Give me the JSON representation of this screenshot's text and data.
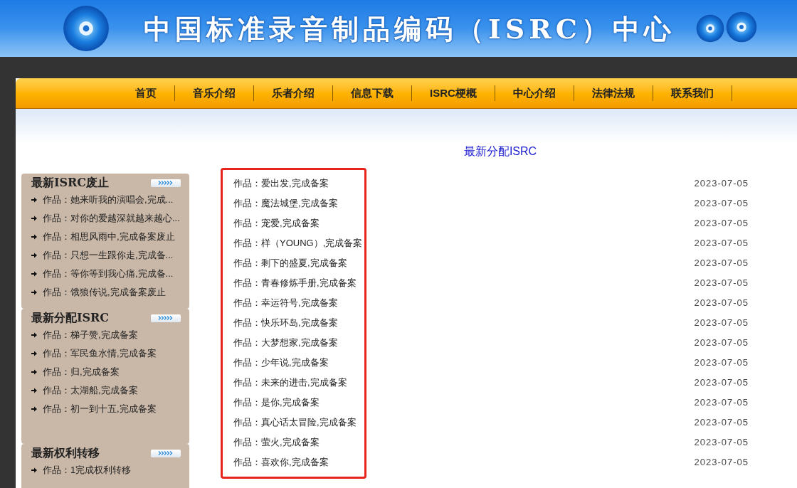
{
  "header": {
    "title": "中国标准录音制品编码（ISRC）中心"
  },
  "nav": [
    {
      "label": "首页"
    },
    {
      "label": "音乐介绍"
    },
    {
      "label": "乐者介绍"
    },
    {
      "label": "信息下载"
    },
    {
      "label": "ISRC梗概"
    },
    {
      "label": "中心介绍"
    },
    {
      "label": "法律法规"
    },
    {
      "label": "联系我们"
    }
  ],
  "sidebar": [
    {
      "title": "最新ISRC废止",
      "items": [
        "作品：她来听我的演唱会,完成...",
        "作品：对你的爱越深就越来越心...",
        "作品：相思风雨中,完成备案废止",
        "作品：只想一生跟你走,完成备...",
        "作品：等你等到我心痛,完成备...",
        "作品：饿狼传说,完成备案废止"
      ]
    },
    {
      "title": "最新分配ISRC",
      "items": [
        "作品：梯子赞,完成备案",
        "作品：军民鱼水情,完成备案",
        "作品：归,完成备案",
        "作品：太湖船,完成备案",
        "作品：初一到十五,完成备案"
      ]
    },
    {
      "title": "最新权利转移",
      "items": [
        "作品：1完成权利转移"
      ]
    }
  ],
  "main": {
    "title": "最新分配ISRC",
    "rows": [
      {
        "text": "作品：爱出发,完成备案",
        "date": "2023-07-05"
      },
      {
        "text": "作品：魔法城堡,完成备案",
        "date": "2023-07-05"
      },
      {
        "text": "作品：宠爱,完成备案",
        "date": "2023-07-05"
      },
      {
        "text": "作品：样（YOUNG）,完成备案",
        "date": "2023-07-05"
      },
      {
        "text": "作品：剩下的盛夏,完成备案",
        "date": "2023-07-05"
      },
      {
        "text": "作品：青春修炼手册,完成备案",
        "date": "2023-07-05"
      },
      {
        "text": "作品：幸运符号,完成备案",
        "date": "2023-07-05"
      },
      {
        "text": "作品：快乐环岛,完成备案",
        "date": "2023-07-05"
      },
      {
        "text": "作品：大梦想家,完成备案",
        "date": "2023-07-05"
      },
      {
        "text": "作品：少年说,完成备案",
        "date": "2023-07-05"
      },
      {
        "text": "作品：未来的进击,完成备案",
        "date": "2023-07-05"
      },
      {
        "text": "作品：是你,完成备案",
        "date": "2023-07-05"
      },
      {
        "text": "作品：真心话太冒险,完成备案",
        "date": "2023-07-05"
      },
      {
        "text": "作品：萤火,完成备案",
        "date": "2023-07-05"
      },
      {
        "text": "作品：喜欢你,完成备案",
        "date": "2023-07-05"
      }
    ]
  }
}
